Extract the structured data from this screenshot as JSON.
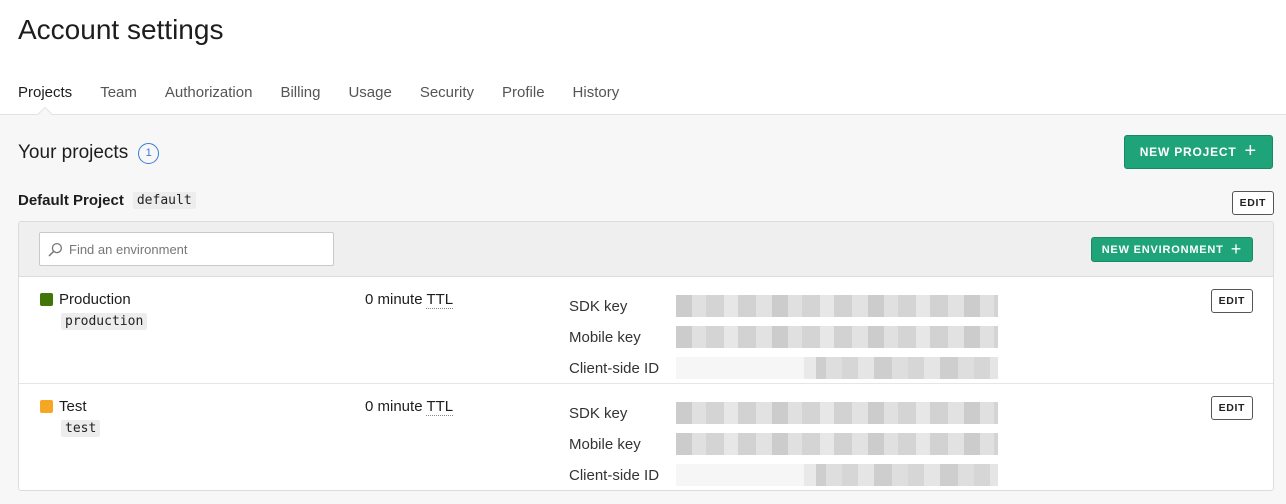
{
  "page": {
    "title": "Account settings"
  },
  "tabs": [
    {
      "label": "Projects",
      "active": true
    },
    {
      "label": "Team"
    },
    {
      "label": "Authorization"
    },
    {
      "label": "Billing"
    },
    {
      "label": "Usage"
    },
    {
      "label": "Security"
    },
    {
      "label": "Profile"
    },
    {
      "label": "History"
    }
  ],
  "projects_section": {
    "title": "Your projects",
    "count": "1",
    "new_project_label": "NEW PROJECT"
  },
  "project": {
    "name": "Default Project",
    "key": "default",
    "edit_label": "EDIT",
    "search_placeholder": "Find an environment",
    "new_environment_label": "NEW ENVIRONMENT"
  },
  "environments": [
    {
      "name": "Production",
      "key": "production",
      "color": "#417505",
      "ttl_value": "0 minute",
      "ttl_unit": "TTL",
      "sdk_key_label": "SDK key",
      "mobile_key_label": "Mobile key",
      "client_id_label": "Client-side ID",
      "edit_label": "EDIT"
    },
    {
      "name": "Test",
      "key": "test",
      "color": "#f5a623",
      "ttl_value": "0 minute",
      "ttl_unit": "TTL",
      "sdk_key_label": "SDK key",
      "mobile_key_label": "Mobile key",
      "client_id_label": "Client-side ID",
      "edit_label": "EDIT"
    }
  ],
  "icons": {
    "search": "search-icon",
    "plus": "plus-icon"
  },
  "colors": {
    "accent": "#1fa47a",
    "badge": "#3a7bd5"
  }
}
